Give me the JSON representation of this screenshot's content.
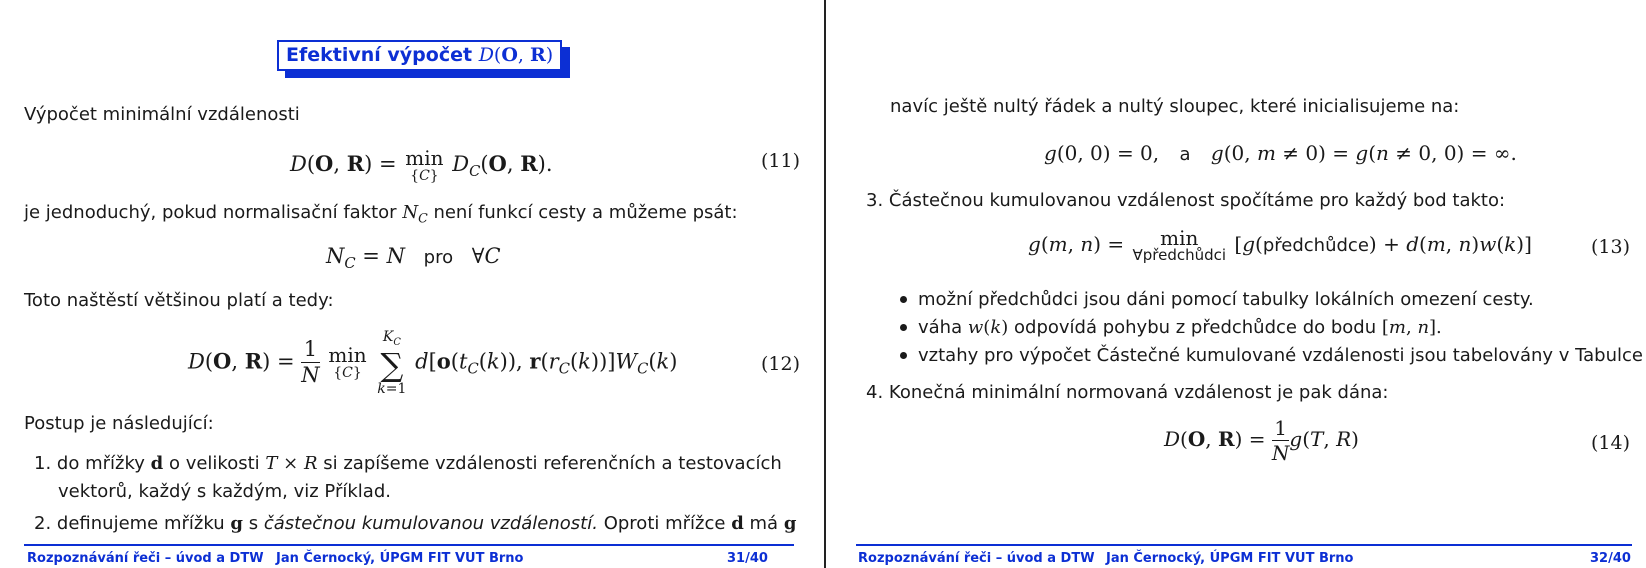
{
  "left_slide": {
    "title_text": "Efektivní výpočet",
    "title_math": "D(O, R)",
    "intro": "Výpočet minimální vzdálenosti",
    "eq11_number": "(11)",
    "line_nc_prefix": "je jednoduchý, pokud normalisační faktor",
    "line_nc_suffix": "není funkcí cesty a můžeme psát:",
    "pro_word": "pro",
    "line_toto": "Toto naštěstí většinou platí a tedy:",
    "eq12_number": "(12)",
    "postup": "Postup je následující:",
    "item1_num": "1.",
    "item1_a": "do mřížky",
    "item1_b": "o velikosti",
    "item1_c": "si zapíšeme vzdálenosti referenčních a testovacích",
    "item1_line2": "vektorů, každý s každým, viz Příklad.",
    "item2_num": "2.",
    "item2_a": "definujeme mřížku",
    "item2_b": "s",
    "item2_c": "částečnou kumulovanou vzdáleností.",
    "item2_d": "Oproti mřížce",
    "item2_e": "má"
  },
  "right_slide": {
    "line_navic": "navíc ještě nultý řádek a nultý sloupec, které inicialisujeme na:",
    "a_word": "a",
    "item3_num": "3.",
    "item3_text": "Částečnou kumulovanou vzdálenost spočítáme pro každý bod takto:",
    "eq13_number": "(13)",
    "predchudci_word": "předchůdci",
    "predchudce_word": "předchůdce",
    "bullets": [
      "možní předchůdci jsou dáni pomocí tabulky lokálních omezení cesty.",
      "vztahy pro výpočet Částečné kumulované vzdálenosti jsou tabelovány v Tabulce"
    ],
    "bullet_vaha_a": "váha",
    "bullet_vaha_b": "odpovídá pohybu z předchůdce do bodu",
    "item4_num": "4.",
    "item4_text": "Konečná minimální normovaná vzdálenost je pak dána:",
    "eq14_number": "(14)"
  },
  "footer": {
    "course": "Rozpoznávání řeči – úvod a DTW",
    "author": "Jan Černocký, ÚPGM FIT VUT Brno",
    "page_left": "31/40",
    "page_right": "32/40"
  },
  "colors": {
    "accent": "#0c2fd4",
    "text": "#1a1a1a"
  }
}
